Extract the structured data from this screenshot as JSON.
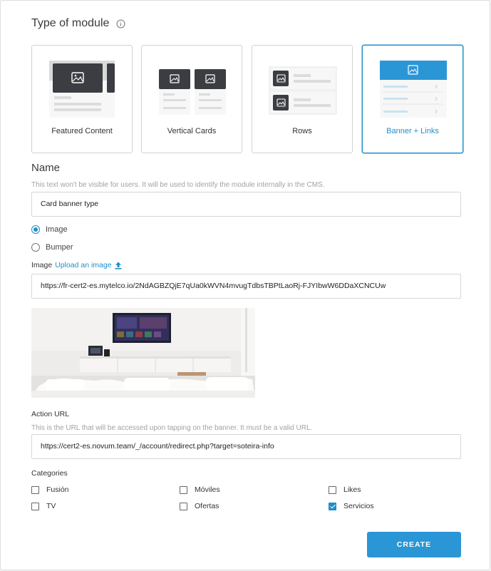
{
  "module_type": {
    "title": "Type of module",
    "options": [
      {
        "label": "Featured Content",
        "selected": false
      },
      {
        "label": "Vertical Cards",
        "selected": false
      },
      {
        "label": "Rows",
        "selected": false
      },
      {
        "label": "Banner + Links",
        "selected": true
      }
    ]
  },
  "name": {
    "title": "Name",
    "hint": "This text won't be visible for users. It will be used to identify the module internally in the CMS.",
    "value": "Card banner type"
  },
  "media_type": {
    "options": [
      {
        "label": "Image",
        "checked": true
      },
      {
        "label": "Bumper",
        "checked": false
      }
    ]
  },
  "image": {
    "label": "Image",
    "upload_link": "Upload an image",
    "url_value": "https://fr-cert2-es.mytelco.io/2NdAGBZQjE7qUa0kWVN4mvugTdbsTBPtLaoRj-FJYIbwW6DDaXCNCUw"
  },
  "action_url": {
    "label": "Action URL",
    "hint": "This is the URL that will be accessed upon tapping on the banner. It must be a valid URL.",
    "value": "https://cert2-es.novum.team/_/account/redirect.php?target=soteira-info"
  },
  "categories": {
    "label": "Categories",
    "items": [
      {
        "label": "Fusión",
        "checked": false
      },
      {
        "label": "Móviles",
        "checked": false
      },
      {
        "label": "Likes",
        "checked": false
      },
      {
        "label": "TV",
        "checked": false
      },
      {
        "label": "Ofertas",
        "checked": false
      },
      {
        "label": "Servicios",
        "checked": true
      }
    ]
  },
  "actions": {
    "create_label": "CREATE"
  },
  "colors": {
    "accent": "#1f8fc9",
    "button": "#2b96d6"
  }
}
